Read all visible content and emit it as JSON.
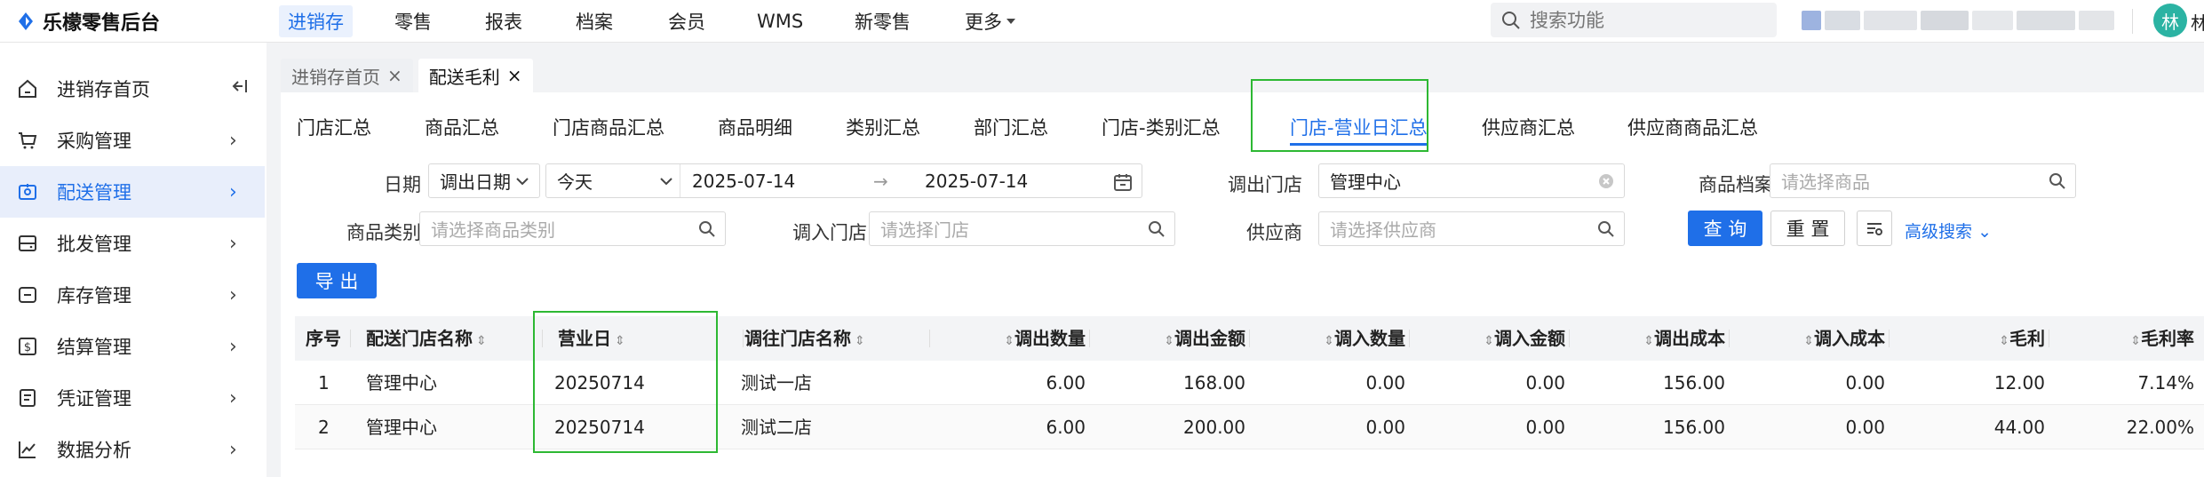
{
  "brand": {
    "name": "乐檬零售后台"
  },
  "topnav": {
    "items": [
      {
        "label": "进销存",
        "active": true
      },
      {
        "label": "零售"
      },
      {
        "label": "报表"
      },
      {
        "label": "档案"
      },
      {
        "label": "会员"
      },
      {
        "label": "WMS"
      },
      {
        "label": "新零售"
      },
      {
        "label": "更多"
      }
    ],
    "search_placeholder": "搜索功能",
    "avatar_initial": "林",
    "avatar_tail": "林"
  },
  "sidebar": {
    "items": [
      {
        "label": "进销存首页",
        "icon": "home-icon",
        "arrow": "collapse"
      },
      {
        "label": "采购管理",
        "icon": "cart-icon",
        "arrow": "›"
      },
      {
        "label": "配送管理",
        "icon": "delivery-icon",
        "arrow": "›",
        "active": true
      },
      {
        "label": "批发管理",
        "icon": "wholesale-icon",
        "arrow": "›"
      },
      {
        "label": "库存管理",
        "icon": "inventory-icon",
        "arrow": "›"
      },
      {
        "label": "结算管理",
        "icon": "settlement-icon",
        "arrow": "›"
      },
      {
        "label": "凭证管理",
        "icon": "voucher-icon",
        "arrow": "›"
      },
      {
        "label": "数据分析",
        "icon": "analytics-icon",
        "arrow": "›"
      }
    ]
  },
  "page_tabs": [
    {
      "label": "进销存首页",
      "close": "×"
    },
    {
      "label": "配送毛利",
      "close": "×",
      "active": true
    }
  ],
  "sub_tabs": [
    {
      "label": "门店汇总"
    },
    {
      "label": "商品汇总"
    },
    {
      "label": "门店商品汇总"
    },
    {
      "label": "商品明细"
    },
    {
      "label": "类别汇总"
    },
    {
      "label": "部门汇总"
    },
    {
      "label": "门店-类别汇总"
    },
    {
      "label": "门店-营业日汇总",
      "active": true
    },
    {
      "label": "供应商汇总"
    },
    {
      "label": "供应商商品汇总"
    }
  ],
  "filters": {
    "date_label": "日期",
    "date_type": "调出日期",
    "date_range_preset": "今天",
    "date_start": "2025-07-14",
    "date_arrow": "→",
    "date_end": "2025-07-14",
    "out_store_label": "调出门店",
    "out_store_value": "管理中心",
    "product_label": "商品档案",
    "product_placeholder": "请选择商品",
    "category_label": "商品类别",
    "category_placeholder": "请选择商品类别",
    "in_store_label": "调入门店",
    "in_store_placeholder": "请选择门店",
    "supplier_label": "供应商",
    "supplier_placeholder": "请选择供应商",
    "query_button": "查 询",
    "reset_button": "重 置",
    "advanced_search": "高级搜索",
    "export_button": "导 出"
  },
  "table": {
    "columns": [
      "序号",
      "配送门店名称",
      "营业日",
      "调往门店名称",
      "调出数量",
      "调出金额",
      "调入数量",
      "调入金额",
      "调出成本",
      "调入成本",
      "毛利",
      "毛利率"
    ],
    "rows": [
      [
        "1",
        "管理中心",
        "20250714",
        "测试一店",
        "6.00",
        "168.00",
        "0.00",
        "0.00",
        "156.00",
        "0.00",
        "12.00",
        "7.14%"
      ],
      [
        "2",
        "管理中心",
        "20250714",
        "测试二店",
        "6.00",
        "200.00",
        "0.00",
        "0.00",
        "156.00",
        "0.00",
        "44.00",
        "22.00%"
      ]
    ]
  },
  "colors": {
    "accent": "#1f6fe8",
    "highlight": "#2db833",
    "avatar": "#2bb3a3"
  }
}
